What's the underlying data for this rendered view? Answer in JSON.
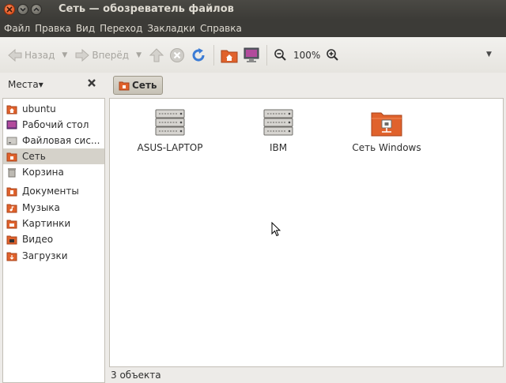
{
  "window": {
    "title": "Сеть — обозреватель файлов"
  },
  "menu": [
    "Файл",
    "Правка",
    "Вид",
    "Переход",
    "Закладки",
    "Справка"
  ],
  "toolbar": {
    "back_label": "Назад",
    "forward_label": "Вперёд",
    "zoom_level": "100%",
    "icons": [
      "back-arrow",
      "forward-arrow",
      "up-arrow",
      "stop",
      "reload",
      "home-folder",
      "computer",
      "zoom-out",
      "zoom-in",
      "dropdown"
    ]
  },
  "location": {
    "places_label": "Места",
    "places_arrow": "▾",
    "crumb": "Сеть"
  },
  "sidebar": {
    "items": [
      {
        "label": "ubuntu",
        "icon": "home-folder"
      },
      {
        "label": "Рабочий стол",
        "icon": "desktop"
      },
      {
        "label": "Файловая сис...",
        "icon": "filesystem"
      },
      {
        "label": "Сеть",
        "icon": "network",
        "active": true
      },
      {
        "label": "Корзина",
        "icon": "trash"
      },
      {
        "label": "Документы",
        "icon": "documents-folder"
      },
      {
        "label": "Музыка",
        "icon": "music-folder"
      },
      {
        "label": "Картинки",
        "icon": "pictures-folder"
      },
      {
        "label": "Видео",
        "icon": "video-folder"
      },
      {
        "label": "Загрузки",
        "icon": "downloads-folder"
      }
    ]
  },
  "content": {
    "items": [
      {
        "label": "ASUS-LAPTOP",
        "icon": "server"
      },
      {
        "label": "IBM",
        "icon": "server"
      },
      {
        "label": "Сеть Windows",
        "icon": "network-folder"
      }
    ]
  },
  "status": {
    "text": "3 объекта"
  },
  "colors": {
    "accent": "#dd4814",
    "titlebar": "#3c3b37",
    "selection": "#d5d2ca"
  }
}
